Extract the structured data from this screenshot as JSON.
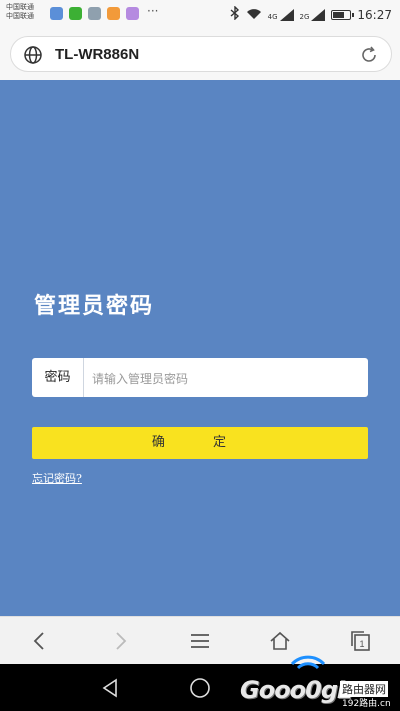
{
  "status_bar": {
    "carrier_1": "中国联通",
    "carrier_2": "中国联通",
    "more": "···",
    "network_1": "4G",
    "network_2": "2G",
    "time": "16:27",
    "battery_level": 0.7,
    "app_icons": [
      {
        "name": "app-icon-1",
        "color": "#5b8fd8"
      },
      {
        "name": "wechat-icon",
        "color": "#3cb034"
      },
      {
        "name": "gallery-icon",
        "color": "#8fa0ae"
      },
      {
        "name": "app-icon-4",
        "color": "#f29a3a"
      },
      {
        "name": "app-icon-5",
        "color": "#b58ae0"
      }
    ]
  },
  "browser": {
    "url": "TL-WR886N"
  },
  "login": {
    "title": "管理员密码",
    "password_label": "密码",
    "password_placeholder": "请输入管理员密码",
    "password_value": "",
    "confirm_label": "确 定",
    "forgot_link": "忘记密码?"
  },
  "watermark": {
    "logo_text": "Gooo0gL",
    "site_text": "路由器网",
    "domain_text": "192路由.cn"
  },
  "colors": {
    "page_background": "#5a85c2",
    "confirm_button": "#f9e21f",
    "nav_background": "#f2f2f2",
    "system_nav": "#000000"
  }
}
